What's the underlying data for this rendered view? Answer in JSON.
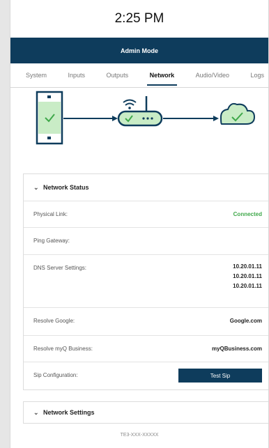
{
  "header": {
    "time": "2:25 PM",
    "mode": "Admin Mode"
  },
  "tabs": [
    {
      "label": "System",
      "active": false
    },
    {
      "label": "Inputs",
      "active": false
    },
    {
      "label": "Outputs",
      "active": false
    },
    {
      "label": "Network",
      "active": true
    },
    {
      "label": "Audio/Video",
      "active": false
    },
    {
      "label": "Logs",
      "active": false
    }
  ],
  "diagram": {
    "status": "connected",
    "accent_color": "#3fa84a",
    "line_color": "#0e3c5c",
    "icons": [
      "device-icon",
      "router-icon",
      "cloud-icon"
    ]
  },
  "network_status": {
    "title": "Network Status",
    "rows": {
      "physical_link": {
        "label": "Physical Link:",
        "value": "Connected"
      },
      "ping_gateway": {
        "label": "Ping Gateway:",
        "value": ""
      },
      "dns": {
        "label": "DNS Server Settings:",
        "values": [
          "10.20.01.11",
          "10.20.01.11",
          "10.20.01.11"
        ]
      },
      "resolve_google": {
        "label": "Resolve Google:",
        "value": "Google.com"
      },
      "resolve_myq": {
        "label": "Resolve myQ Business:",
        "value": "myQBusiness.com"
      },
      "sip": {
        "label": "Sip Configuration:",
        "button": "Test Sip"
      }
    }
  },
  "network_settings": {
    "title": "Network Settings"
  },
  "footer": {
    "serial": "TE3-XXX-XXXXX"
  }
}
